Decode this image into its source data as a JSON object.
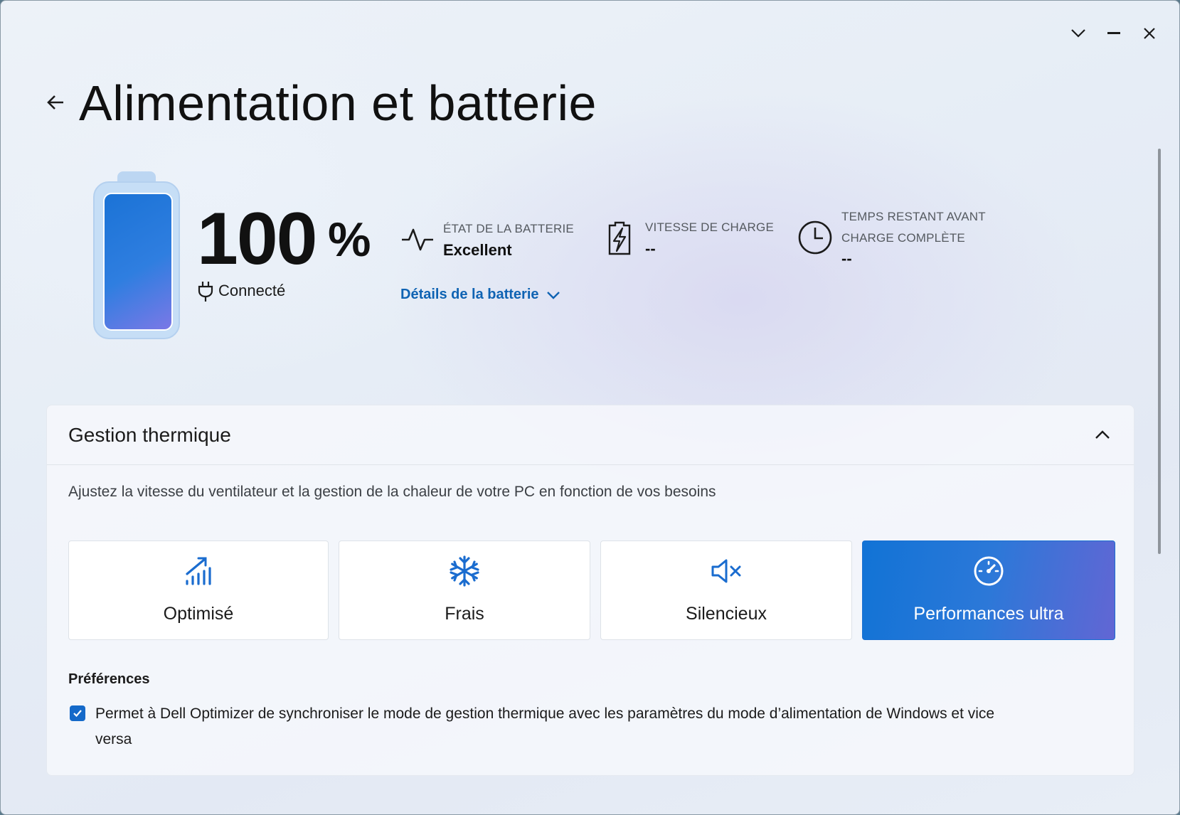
{
  "window": {
    "controls": [
      {
        "name": "chevron-down-icon"
      },
      {
        "name": "minimize-icon"
      },
      {
        "name": "close-icon"
      }
    ]
  },
  "header": {
    "title": "Alimentation et batterie",
    "back_icon": "arrow-left-icon"
  },
  "battery": {
    "level_percent": 100,
    "value": "100",
    "unit": "%",
    "status_icon": "plug-icon",
    "status_label": "Connecté",
    "fill_colors": [
      "#1b73d6",
      "#7b78e6"
    ]
  },
  "metrics": {
    "health": {
      "icon": "pulse-icon",
      "label": "ÉTAT DE LA BATTERIE",
      "value": "Excellent"
    },
    "charge_speed": {
      "icon": "battery-charging-icon",
      "label": "VITESSE DE CHARGE",
      "value": "--"
    },
    "time_remaining": {
      "icon": "clock-icon",
      "label_line1": "TEMPS RESTANT AVANT",
      "label_line2": "CHARGE COMPLÈTE",
      "value": "--"
    },
    "details_link": "Détails de la batterie"
  },
  "thermal": {
    "title": "Gestion thermique",
    "expanded": true,
    "description": "Ajustez la vitesse du ventilateur et la gestion de la chaleur de votre PC en fonction de vos besoins",
    "modes": [
      {
        "label": "Optimisé",
        "icon": "signal-bars-icon",
        "selected": false
      },
      {
        "label": "Frais",
        "icon": "snowflake-icon",
        "selected": false
      },
      {
        "label": "Silencieux",
        "icon": "speaker-mute-icon",
        "selected": false
      },
      {
        "label": "Performances ultra",
        "icon": "speedometer-icon",
        "selected": true
      }
    ],
    "preferences_title": "Préférences",
    "sync_checkbox": {
      "checked": true,
      "label": "Permet à Dell Optimizer de synchroniser le mode de gestion thermique avec les paramètres du mode d’alimentation de Windows et vice versa"
    }
  },
  "colors": {
    "accent": "#1173d6",
    "link": "#0f63b3",
    "checkbox": "#1469c9"
  }
}
